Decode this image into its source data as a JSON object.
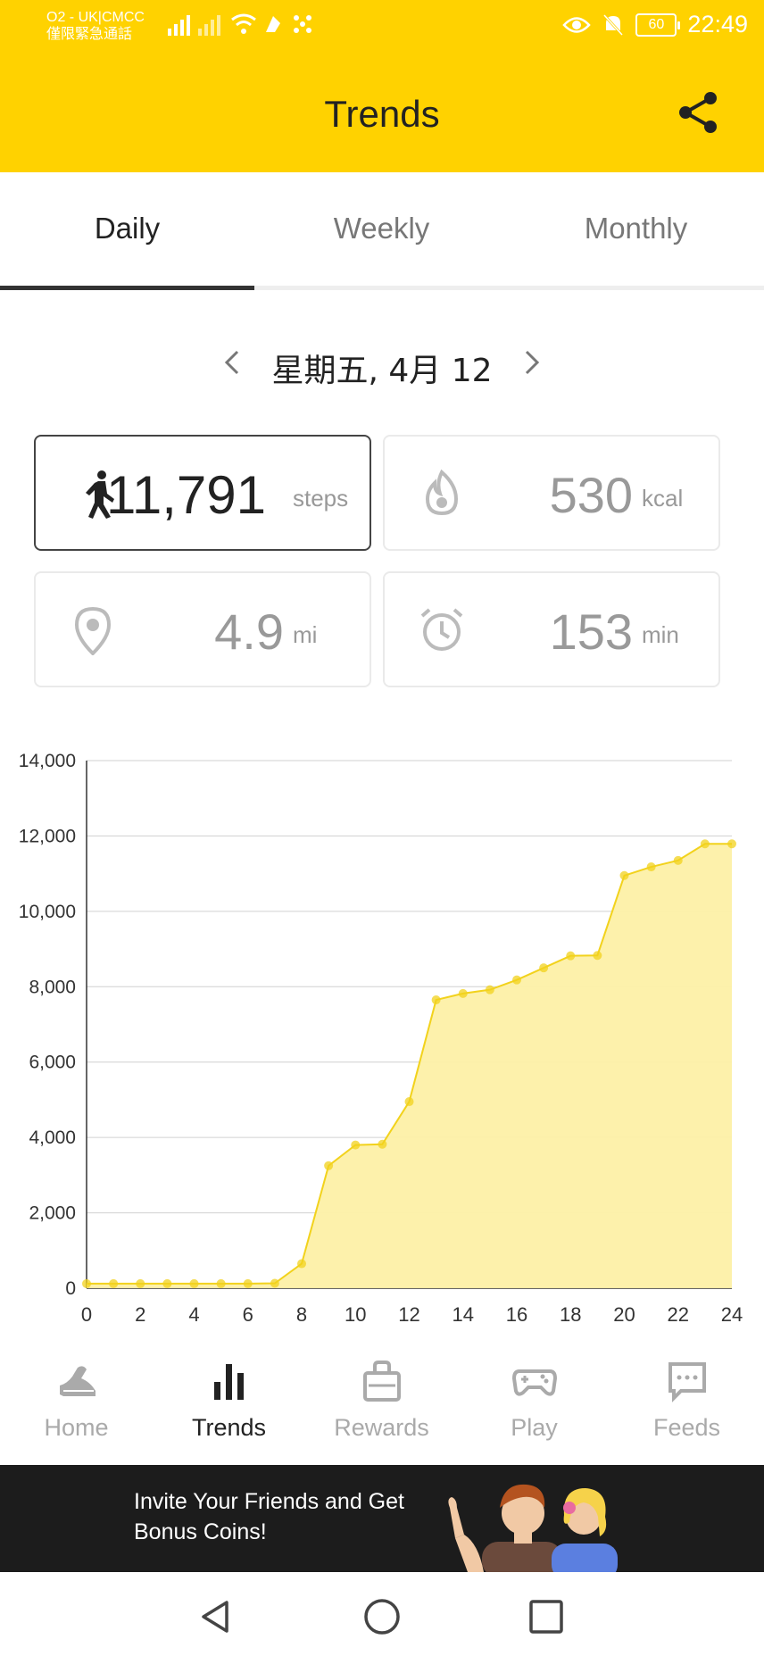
{
  "status_bar": {
    "carrier_line1": "O2 - UK|CMCC",
    "carrier_line2": "僅限緊急通話",
    "battery": "60",
    "time": "22:49"
  },
  "header": {
    "title": "Trends"
  },
  "tabs": [
    {
      "label": "Daily",
      "active": true
    },
    {
      "label": "Weekly",
      "active": false
    },
    {
      "label": "Monthly",
      "active": false
    }
  ],
  "date_nav": {
    "label": "星期五, 4月 12"
  },
  "stats": {
    "steps": {
      "value": "11,791",
      "unit": "steps"
    },
    "calories": {
      "value": "530",
      "unit": "kcal"
    },
    "distance": {
      "value": "4.9",
      "unit": "mi"
    },
    "duration": {
      "value": "153",
      "unit": "min"
    }
  },
  "colors": {
    "accent": "#FFD200",
    "chart_line": "#F2D21C",
    "chart_fill": "#FDF0A6"
  },
  "chart_data": {
    "type": "area",
    "x": [
      0,
      1,
      2,
      3,
      4,
      5,
      6,
      7,
      8,
      9,
      10,
      11,
      12,
      13,
      14,
      15,
      16,
      17,
      18,
      19,
      20,
      21,
      22,
      23,
      24
    ],
    "values": [
      120,
      120,
      120,
      120,
      120,
      120,
      120,
      130,
      650,
      3250,
      3800,
      3820,
      4950,
      7650,
      7820,
      7920,
      8180,
      8500,
      8820,
      8830,
      10950,
      11180,
      11350,
      11791,
      11791
    ],
    "x_ticks": [
      "0",
      "2",
      "4",
      "6",
      "8",
      "10",
      "12",
      "14",
      "16",
      "18",
      "20",
      "22",
      "24"
    ],
    "y_ticks": [
      "0",
      "2,000",
      "4,000",
      "6,000",
      "8,000",
      "10,000",
      "12,000",
      "14,000"
    ],
    "ylim": [
      0,
      14000
    ],
    "xlim": [
      0,
      24
    ],
    "grid": true
  },
  "bottom_nav": [
    {
      "label": "Home",
      "icon": "shoe-icon",
      "active": false
    },
    {
      "label": "Trends",
      "icon": "bar-chart-icon",
      "active": true
    },
    {
      "label": "Rewards",
      "icon": "shopping-bag-icon",
      "active": false
    },
    {
      "label": "Play",
      "icon": "gamepad-icon",
      "active": false
    },
    {
      "label": "Feeds",
      "icon": "chat-bubble-icon",
      "active": false
    }
  ],
  "banner": {
    "text": "Invite Your Friends and Get Bonus Coins!"
  }
}
